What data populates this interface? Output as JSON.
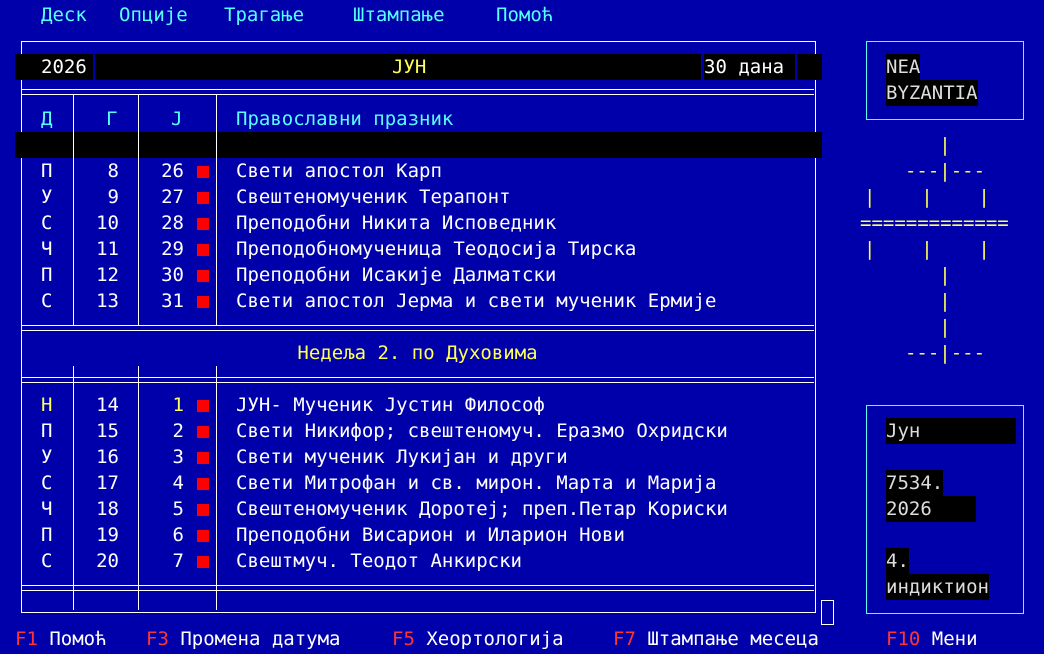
{
  "menu": [
    "Деск",
    "Опције",
    "Трагање",
    "Штампање",
    "Помоћ"
  ],
  "header": {
    "year": "2026",
    "month": "ЈУН",
    "days": "30 дана"
  },
  "columns": {
    "d": "Д",
    "g": "Г",
    "j": "Ј",
    "feast": "Православни празник"
  },
  "week1": [
    {
      "d": "П",
      "g": "8",
      "j": "26",
      "feast": "Свети апостол Карп"
    },
    {
      "d": "У",
      "g": "9",
      "j": "27",
      "feast": "Свештеномученик Терапонт"
    },
    {
      "d": "С",
      "g": "10",
      "j": "28",
      "feast": "Преподобни Никита Исповедник"
    },
    {
      "d": "Ч",
      "g": "11",
      "j": "29",
      "feast": "Преподобномученица Теодосија Тирска"
    },
    {
      "d": "П",
      "g": "12",
      "j": "30",
      "feast": "Преподобни Исакије Далматски"
    },
    {
      "d": "С",
      "g": "13",
      "j": "31",
      "feast": "Свети апостол Јерма и свети мученик Ермије"
    }
  ],
  "week_title": "Недеља 2. по Духовима",
  "week2": [
    {
      "d": "Н",
      "g": "14",
      "j": "1",
      "feast": "ЈУН- Мученик Јустин Философ"
    },
    {
      "d": "П",
      "g": "15",
      "j": "2",
      "feast": "Свети Никифор; свештеномуч. Еразмо Охридски"
    },
    {
      "d": "У",
      "g": "16",
      "j": "3",
      "feast": "Свети мученик Лукијан и други"
    },
    {
      "d": "С",
      "g": "17",
      "j": "4",
      "feast": "Свети Митрофан и св. мирон. Марта и Марија"
    },
    {
      "d": "Ч",
      "g": "18",
      "j": "5",
      "feast": "Свештеномученик Доротеј; преп.Петар Кориски"
    },
    {
      "d": "П",
      "g": "19",
      "j": "6",
      "feast": "Преподобни Висарион и Иларион Нови"
    },
    {
      "d": "С",
      "g": "20",
      "j": "7",
      "feast": "Свештмуч. Теодот Анкирски"
    }
  ],
  "logo": {
    "line1": "NEA",
    "line2": "BYZANTIA"
  },
  "cross_art": [
    "|",
    "---|---",
    "|    |    |",
    "=============",
    "|    |    |",
    "|",
    "|",
    "|",
    "---|---"
  ],
  "info": {
    "month": "Јун",
    "year_world": "7534.",
    "year": "2026",
    "indiction_num": "4.",
    "indiction": "индиктион"
  },
  "fkeys": [
    {
      "key": "F1",
      "label": "Помоћ"
    },
    {
      "key": "F3",
      "label": "Промена датума"
    },
    {
      "key": "F5",
      "label": "Хеортологија"
    },
    {
      "key": "F7",
      "label": "Штампање месеца"
    },
    {
      "key": "F10",
      "label": "Мени"
    }
  ],
  "colors": {
    "background": "#0000aa",
    "text": "#ffffff",
    "accent": "#55ffff",
    "highlight": "#ffff55",
    "marker": "#ff0000",
    "fkey": "#ff3333"
  }
}
